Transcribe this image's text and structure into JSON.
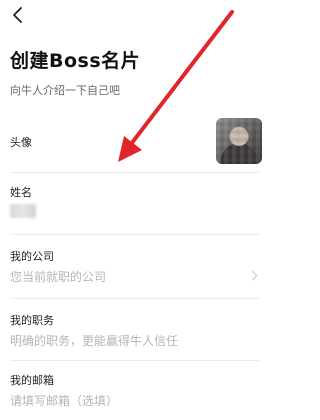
{
  "header": {
    "title": "创建Boss名片",
    "subtitle": "向牛人介绍一下自己吧",
    "back_icon": "chevron-left-icon"
  },
  "form": {
    "avatar": {
      "label": "头像"
    },
    "name": {
      "label": "姓名"
    },
    "company": {
      "label": "我的公司",
      "placeholder": "您当前就职的公司"
    },
    "position": {
      "label": "我的职务",
      "placeholder": "明确的职务，更能赢得牛人信任"
    },
    "email": {
      "label": "我的邮箱",
      "placeholder": "请填写邮箱（选填）"
    }
  },
  "annotation": {
    "arrow_color": "#e0262b"
  }
}
